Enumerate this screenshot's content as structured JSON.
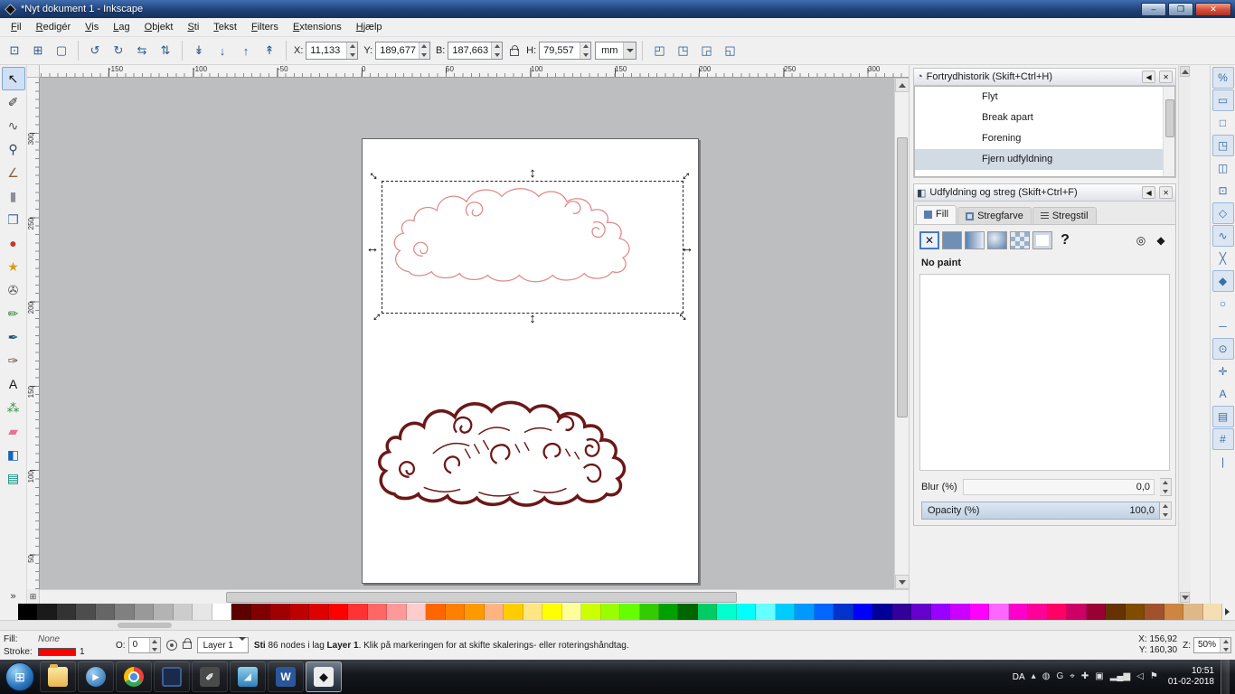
{
  "window": {
    "title": "*Nyt dokument 1 - Inkscape",
    "buttons": {
      "minimize": "–",
      "maximize": "❐",
      "close": "✕"
    }
  },
  "menu": {
    "items": [
      "Fil",
      "Redigér",
      "Vis",
      "Lag",
      "Objekt",
      "Sti",
      "Tekst",
      "Filters",
      "Extensions",
      "Hjælp"
    ]
  },
  "toolbar": {
    "select_icons": [
      {
        "name": "select-all-icon",
        "glyph": "⊡"
      },
      {
        "name": "select-all-layers-icon",
        "glyph": "⊞"
      },
      {
        "name": "deselect-icon",
        "glyph": "▢"
      }
    ],
    "rotate_flip_icons": [
      {
        "name": "rotate-ccw-icon",
        "glyph": "↺"
      },
      {
        "name": "rotate-cw-icon",
        "glyph": "↻"
      },
      {
        "name": "flip-horizontal-icon",
        "glyph": "⇆"
      },
      {
        "name": "flip-vertical-icon",
        "glyph": "⇅"
      }
    ],
    "zorder_icons": [
      {
        "name": "lower-to-bottom-icon",
        "glyph": "↡"
      },
      {
        "name": "lower-icon",
        "glyph": "↓"
      },
      {
        "name": "raise-icon",
        "glyph": "↑"
      },
      {
        "name": "raise-to-top-icon",
        "glyph": "↟"
      }
    ],
    "x": {
      "label": "X:",
      "value": "11,133"
    },
    "y": {
      "label": "Y:",
      "value": "189,677"
    },
    "b": {
      "label": "B:",
      "value": "187,663"
    },
    "h": {
      "label": "H:",
      "value": "79,557"
    },
    "unit": "mm",
    "affect_icons": [
      {
        "name": "affect-stroke-icon",
        "glyph": "◰",
        "active": true
      },
      {
        "name": "affect-corners-icon",
        "glyph": "◳",
        "active": true
      },
      {
        "name": "affect-gradient-icon",
        "glyph": "◲",
        "active": true
      },
      {
        "name": "affect-pattern-icon",
        "glyph": "◱",
        "active": true
      }
    ]
  },
  "toolbox": {
    "overflow": "»",
    "tools": [
      {
        "name": "selector-tool",
        "glyph": "↖",
        "color": "#111111",
        "active": true
      },
      {
        "name": "node-tool",
        "glyph": "✐",
        "color": "#333333"
      },
      {
        "name": "tweak-tool",
        "glyph": "∿",
        "color": "#555555"
      },
      {
        "name": "zoom-tool",
        "glyph": "⚲",
        "color": "#334466"
      },
      {
        "name": "measure-tool",
        "glyph": "∠",
        "color": "#886644"
      },
      {
        "name": "rectangle-tool",
        "glyph": "▮",
        "color": "#8a8f98"
      },
      {
        "name": "box3d-tool",
        "glyph": "❒",
        "color": "#4a6fa5"
      },
      {
        "name": "ellipse-tool",
        "glyph": "●",
        "color": "#c0392b"
      },
      {
        "name": "star-tool",
        "glyph": "★",
        "color": "#d4a017"
      },
      {
        "name": "spiral-tool",
        "glyph": "✇",
        "color": "#555555"
      },
      {
        "name": "pencil-tool",
        "glyph": "✏",
        "color": "#2e7d32"
      },
      {
        "name": "bezier-tool",
        "glyph": "✒",
        "color": "#1a5276"
      },
      {
        "name": "calligraphy-tool",
        "glyph": "✑",
        "color": "#6d4c41"
      },
      {
        "name": "text-tool",
        "glyph": "A",
        "color": "#111111"
      },
      {
        "name": "spray-tool",
        "glyph": "⁂",
        "color": "#388e3c"
      },
      {
        "name": "eraser-tool",
        "glyph": "▰",
        "color": "#e57393"
      },
      {
        "name": "paintbucket-tool",
        "glyph": "◧",
        "color": "#1565c0"
      },
      {
        "name": "gradient-tool",
        "glyph": "▤",
        "color": "#00897b"
      }
    ]
  },
  "rulers": {
    "top": [
      {
        "t": "-150",
        "p": 76
      },
      {
        "t": "-100",
        "p": 169
      },
      {
        "t": "-50",
        "p": 263
      },
      {
        "t": "0",
        "p": 356
      },
      {
        "t": "50",
        "p": 449
      },
      {
        "t": "100",
        "p": 543
      },
      {
        "t": "150",
        "p": 636
      },
      {
        "t": "200",
        "p": 729
      },
      {
        "t": "250",
        "p": 823
      },
      {
        "t": "300",
        "p": 916
      }
    ],
    "left": [
      {
        "t": "300",
        "p": 61
      },
      {
        "t": "250",
        "p": 155
      },
      {
        "t": "200",
        "p": 248
      },
      {
        "t": "150",
        "p": 341
      },
      {
        "t": "100",
        "p": 435
      },
      {
        "t": "50",
        "p": 528
      }
    ]
  },
  "panels": {
    "panel_buttons": {
      "collapse": "◀",
      "close": "✕"
    },
    "undo_history": {
      "title": "Fortrydhistorik (Skift+Ctrl+H)",
      "icon": "◔",
      "items": [
        {
          "label": "Flyt"
        },
        {
          "label": "Break apart"
        },
        {
          "label": "Forening"
        },
        {
          "label": "Fjern udfyldning",
          "selected": true
        }
      ]
    },
    "fill_stroke": {
      "title": "Udfyldning og streg (Skift+Ctrl+F)",
      "icon": "◧",
      "tabs": [
        {
          "label": "Fill",
          "kind": "fill",
          "active": true
        },
        {
          "label": "Stregfarve",
          "kind": "spaint"
        },
        {
          "label": "Stregstil",
          "kind": "sstyle"
        }
      ],
      "paint_buttons": [
        {
          "name": "paint-none-button",
          "glyph": "✕",
          "kind": "x",
          "active": true
        },
        {
          "name": "paint-flat-button",
          "kind": "flat"
        },
        {
          "name": "paint-linear-gradient-button",
          "kind": "lin"
        },
        {
          "name": "paint-radial-gradient-button",
          "kind": "rad"
        },
        {
          "name": "paint-pattern-button",
          "kind": "pat"
        },
        {
          "name": "paint-swatch-button",
          "kind": "sw"
        },
        {
          "name": "paint-unknown-button",
          "glyph": "?",
          "kind": "unk"
        }
      ],
      "fillrule_evenodd": "◎",
      "fillrule_nonzero": "◆",
      "no_paint_text": "No paint",
      "blur_label": "Blur (%)",
      "blur_value": "0,0",
      "opacity_label": "Opacity (%)",
      "opacity_value": "100,0",
      "opacity_percent": 100
    }
  },
  "snapbar": [
    {
      "name": "snap-enable-button",
      "glyph": "%",
      "active": true
    },
    {
      "name": "snap-bbox-button",
      "glyph": "▭",
      "active": true
    },
    {
      "name": "snap-bbox-edge-button",
      "glyph": "□"
    },
    {
      "name": "snap-bbox-corner-button",
      "glyph": "◳",
      "active": true
    },
    {
      "name": "snap-bbox-midpoint-button",
      "glyph": "◫"
    },
    {
      "name": "snap-bbox-center-button",
      "glyph": "⊡"
    },
    {
      "name": "snap-node-button",
      "glyph": "◇",
      "active": true
    },
    {
      "name": "snap-path-button",
      "glyph": "∿",
      "active": true
    },
    {
      "name": "snap-intersection-button",
      "glyph": "╳"
    },
    {
      "name": "snap-cusp-node-button",
      "glyph": "◆",
      "active": true
    },
    {
      "name": "snap-smooth-node-button",
      "glyph": "○"
    },
    {
      "name": "snap-midpoint-button",
      "glyph": "─"
    },
    {
      "name": "snap-object-center-button",
      "glyph": "⊙",
      "active": true
    },
    {
      "name": "snap-rotation-center-button",
      "glyph": "✛"
    },
    {
      "name": "snap-text-baseline-button",
      "glyph": "A"
    },
    {
      "name": "snap-page-border-button",
      "glyph": "▤",
      "active": true
    },
    {
      "name": "snap-grid-button",
      "glyph": "#",
      "active": true
    },
    {
      "name": "snap-guide-button",
      "glyph": "|"
    }
  ],
  "palette": {
    "colors": [
      "#000000",
      "#1a1a1a",
      "#333333",
      "#4d4d4d",
      "#666666",
      "#808080",
      "#999999",
      "#b3b3b3",
      "#cccccc",
      "#e6e6e6",
      "#ffffff",
      "#5f0000",
      "#800000",
      "#a00000",
      "#bf0000",
      "#df0000",
      "#ff0000",
      "#ff3333",
      "#ff6666",
      "#ff9999",
      "#ffcccc",
      "#ff6600",
      "#ff8000",
      "#ff9900",
      "#ffb380",
      "#ffcc00",
      "#ffe680",
      "#ffff00",
      "#ffff99",
      "#ccff00",
      "#99ff00",
      "#66ff00",
      "#33cc00",
      "#00a000",
      "#006600",
      "#00cc66",
      "#00ffcc",
      "#00ffff",
      "#66ffff",
      "#00ccff",
      "#0099ff",
      "#0066ff",
      "#0033cc",
      "#0000ff",
      "#000099",
      "#330099",
      "#6600cc",
      "#9900ff",
      "#cc00ff",
      "#ff00ff",
      "#ff66ff",
      "#ff00cc",
      "#ff0099",
      "#ff0066",
      "#cc0066",
      "#990033",
      "#663300",
      "#804d00",
      "#a0522d",
      "#cd853f",
      "#deb887",
      "#f5deb3"
    ]
  },
  "statusbar": {
    "fill_label": "Fill:",
    "fill_value": "None",
    "stroke_label": "Stroke:",
    "stroke_color": "#ff0000",
    "stroke_width": "1",
    "opacity_label": "O:",
    "opacity_value": "0",
    "layer_name": "Layer 1",
    "message_parts": [
      {
        "text": "Sti",
        "bold": true
      },
      {
        "text": " 86 nodes i lag ",
        "bold": false
      },
      {
        "text": "Layer 1",
        "bold": true
      },
      {
        "text": ". Klik på markeringen for at skifte skalerings- eller roteringshåndtag.",
        "bold": false
      }
    ],
    "x_label": "X:",
    "x_value": "156,92",
    "y_label": "Y:",
    "y_value": "160,30",
    "z_label": "Z:",
    "zoom_value": "50%"
  },
  "taskbar": {
    "language": "DA",
    "time": "10:51",
    "date": "01-02-2018",
    "apps": [
      {
        "name": "explorer",
        "glyph": ""
      },
      {
        "name": "media-player",
        "glyph": "▶"
      },
      {
        "name": "chrome",
        "glyph": ""
      },
      {
        "name": "pinned-app",
        "glyph": ""
      },
      {
        "name": "gimp",
        "glyph": "✐"
      },
      {
        "name": "photo-viewer",
        "glyph": "◢"
      },
      {
        "name": "word",
        "glyph": "W"
      },
      {
        "name": "inkscape",
        "glyph": "◆",
        "active": true
      }
    ],
    "tray": [
      {
        "name": "hidden-icons-chevron",
        "glyph": "▴"
      },
      {
        "name": "power-icon",
        "glyph": "◍"
      },
      {
        "name": "google-icon",
        "glyph": "G"
      },
      {
        "name": "location-icon",
        "glyph": "⌖"
      },
      {
        "name": "security-icon",
        "glyph": "✚"
      },
      {
        "name": "display-icon",
        "glyph": "▣"
      },
      {
        "name": "network-icon",
        "glyph": "▂▄▆"
      },
      {
        "name": "volume-icon",
        "glyph": "◁"
      },
      {
        "name": "flag-icon",
        "glyph": "⚑"
      }
    ]
  }
}
